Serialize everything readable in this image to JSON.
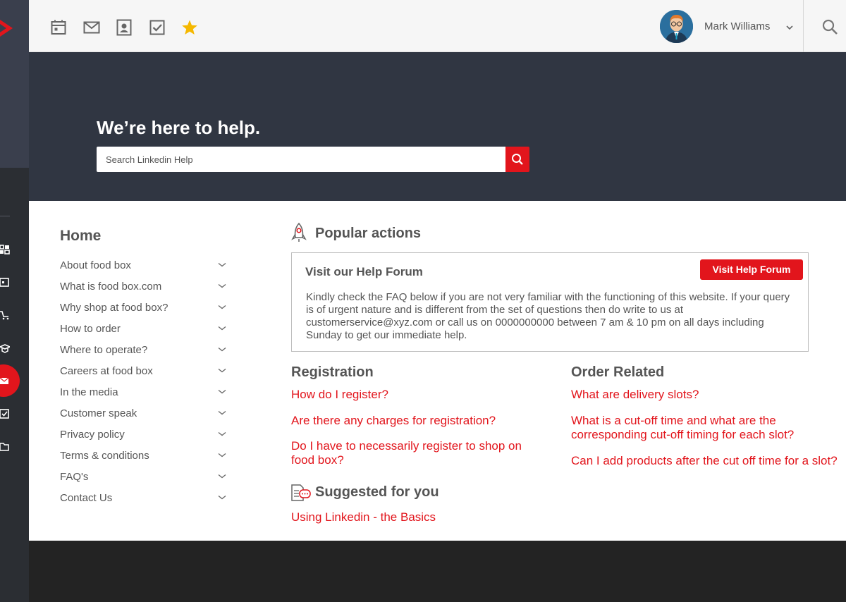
{
  "header": {
    "user_name": "Mark Williams",
    "icons": [
      "calendar-icon",
      "mail-icon",
      "contact-card-icon",
      "checkbox-icon",
      "star-icon",
      "search-icon"
    ],
    "colors": {
      "accent": "#e2151c",
      "star": "#f5b800",
      "bar": "#f6f6f6"
    }
  },
  "hero": {
    "title": "We’re here to help.",
    "search_placeholder": "Search Linkedin Help"
  },
  "nav": {
    "title": "Home",
    "items": [
      "About food box",
      "What is food box.com",
      "Why shop at food box?",
      "How to order",
      "Where to operate?",
      "Careers at food box",
      "In the media",
      "Customer speak",
      "Privacy policy",
      "Terms & conditions",
      "FAQ's",
      "Contact Us"
    ]
  },
  "popular": {
    "title": "Popular actions",
    "forum_title": "Visit our Help Forum",
    "forum_button": "Visit Help Forum",
    "forum_text": "Kindly check the FAQ below if you are not very familiar with the functioning of this website. If your query is of urgent nature and is different from the set of questions then do write to us at customerservice@xyz.com or call us on 0000000000 between 7 am & 10 pm on all days including Sunday to get our immediate help."
  },
  "registration": {
    "title": "Registration",
    "questions": [
      "How do I register?",
      "Are there any charges for registration?",
      "Do I have to necessarily register to shop on food box?"
    ]
  },
  "order": {
    "title": "Order Related",
    "questions": [
      "What are delivery slots?",
      "What is a cut-off time and what are the corresponding cut-off timing for each slot?",
      "Can I add products after the cut off time for a slot?"
    ]
  },
  "suggested": {
    "title": "Suggested for you",
    "links": [
      "Using Linkedin - the Basics"
    ]
  }
}
